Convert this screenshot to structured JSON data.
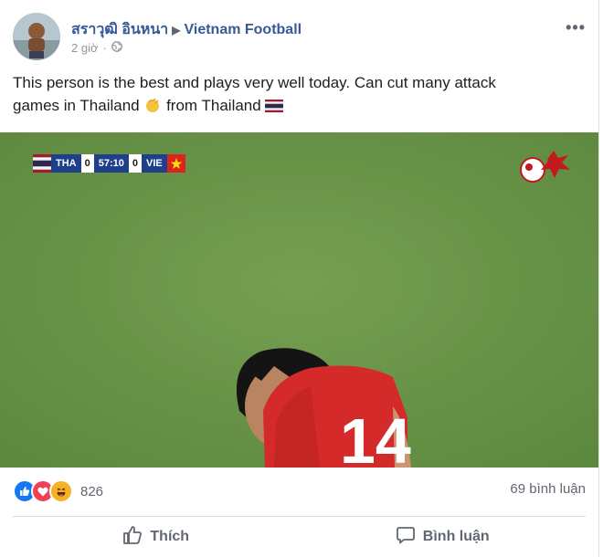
{
  "post": {
    "author": "สราวุฒิ อินหนา",
    "group": "Vietnam Football",
    "time": "2 giờ",
    "text_line1": "This person is the best and plays very well today. Can cut many attack",
    "text_line2_a": "games in Thailand",
    "text_line2_b": "from Thailand"
  },
  "video": {
    "scorebug": {
      "home": "THA",
      "home_score": "0",
      "clock": "57:10",
      "away_score": "0",
      "away": "VIE"
    },
    "player_number": "14"
  },
  "stats": {
    "reaction_count": "826",
    "comments": "69 bình luận"
  },
  "actions": {
    "like": "Thích",
    "comment": "Bình luận"
  },
  "colors": {
    "link": "#385898",
    "muted": "#606770",
    "pitch": "#6f9a4a",
    "jersey": "#d42a2a"
  },
  "icons": [
    "globe-icon",
    "more-icon",
    "like-reaction-icon",
    "love-reaction-icon",
    "haha-reaction-icon",
    "thumbs-up-icon",
    "comment-icon",
    "clap-emoji",
    "thai-flag-emoji"
  ]
}
